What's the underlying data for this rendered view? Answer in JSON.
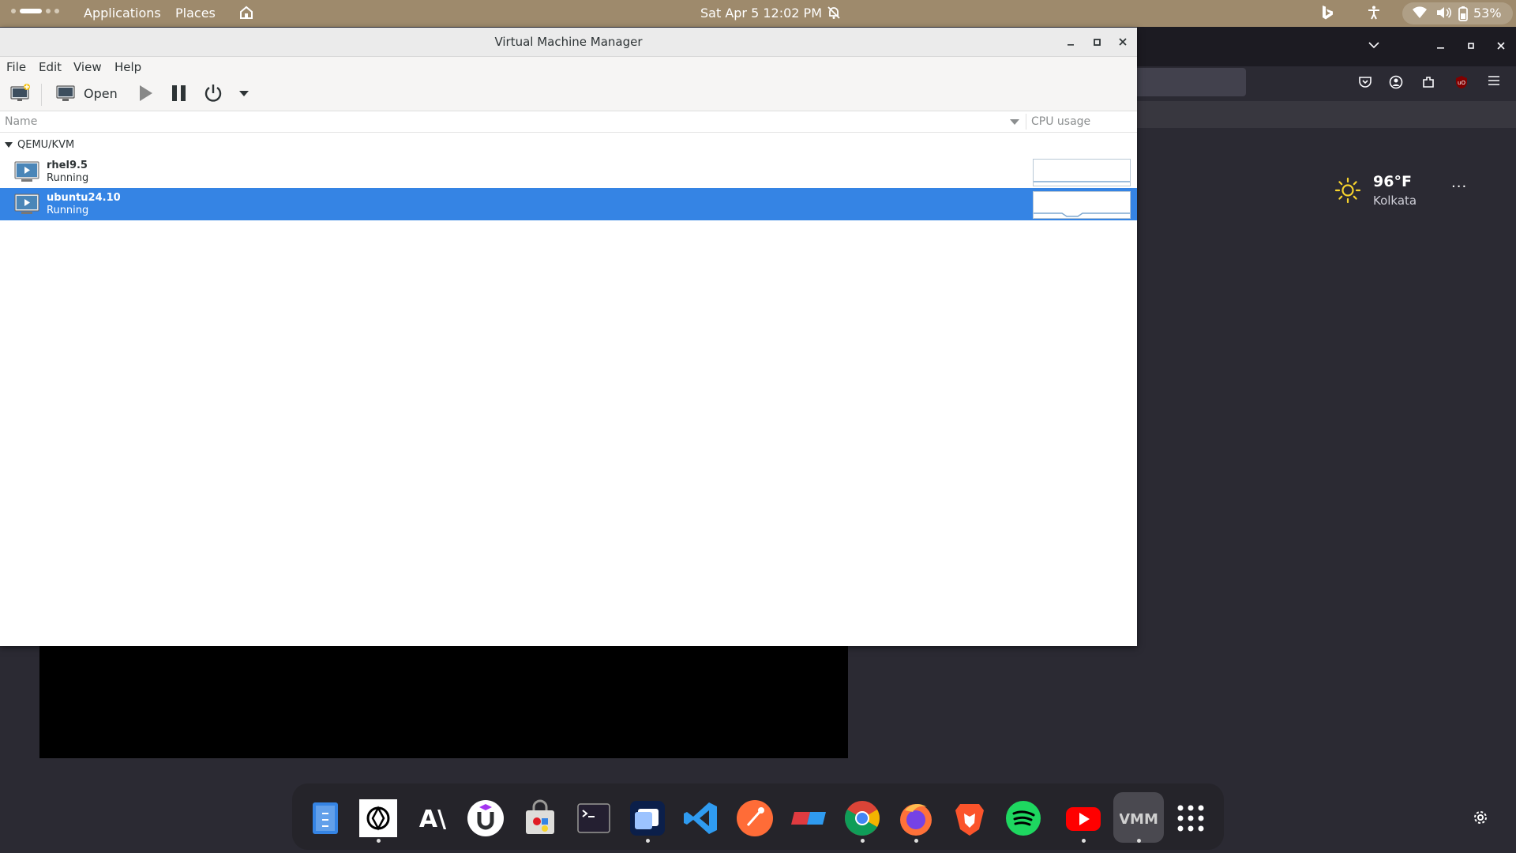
{
  "topbar": {
    "applications_label": "Applications",
    "places_label": "Places",
    "clock": "Sat Apr 5  12:02 PM",
    "battery_percent": "53%"
  },
  "weather": {
    "temperature": "96°F",
    "city": "Kolkata",
    "more_label": "···"
  },
  "vmm": {
    "title": "Virtual Machine Manager",
    "menu": [
      "File",
      "Edit",
      "View",
      "Help"
    ],
    "toolbar": {
      "open_label": "Open"
    },
    "columns": {
      "name": "Name",
      "cpu": "CPU usage"
    },
    "group": "QEMU/KVM",
    "vms": [
      {
        "name": "rhel9.5",
        "status": "Running",
        "selected": false
      },
      {
        "name": "ubuntu24.10",
        "status": "Running",
        "selected": true
      }
    ]
  },
  "dock": {
    "apps": [
      "files-icon",
      "chatgpt-icon",
      "anthropic-icon",
      "udemy-icon",
      "software-store-icon",
      "terminal-icon",
      "remote-desktop-icon",
      "vscode-icon",
      "postman-icon",
      "anydesk-icon",
      "chrome-icon",
      "firefox-icon",
      "brave-icon",
      "spotify-icon",
      "youtube-icon",
      "virt-manager-icon",
      "app-grid-icon"
    ]
  },
  "colors": {
    "topbar": "#9e8a6c",
    "selection": "#3584e4",
    "desktop": "#2b2a33"
  }
}
